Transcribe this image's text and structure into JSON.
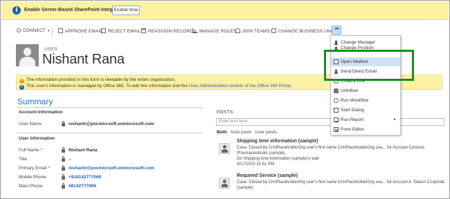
{
  "notification": {
    "text": "Enable Server-Based SharePoint Integration",
    "button": "Enable Now"
  },
  "commands": {
    "connect": "CONNECT",
    "approve_email": "APPROVE EMAIL",
    "reject_email": "REJECT EMAIL",
    "reassign_records": "REASSIGN RECORDS",
    "manage_roles": "MANAGE ROLES",
    "join_teams": "JOIN TEAMS",
    "change_business_unit": "CHANGE BUSINESS UNIT",
    "more": "•••"
  },
  "header": {
    "entity": "USER",
    "name": "Nishant Rana"
  },
  "infostrip": {
    "line1": "The information provided in this form is viewable by the entire organization.",
    "line2_prefix": "This user's information is managed by Office 365. To edit this information visit the ",
    "line2_link": "User Administration section of the Office 365 Portal",
    "line2_suffix": "."
  },
  "summary": {
    "title": "Summary",
    "account_section": "Account Information",
    "user_name_label": "User Name",
    "user_name_value": "nishantr@pocmicrsoft.onmicrosoft.com",
    "user_section": "User Information",
    "full_name_label": "Full Name",
    "full_name_value": "Nishant Rana",
    "title_label": "Title",
    "title_value": "--",
    "primary_email_label": "Primary Email",
    "primary_email_value": "nishantr@pocmicrsoft.onmicrosoft.com",
    "mobile_phone_label": "Mobile Phone",
    "mobile_phone_value": "+918142777069",
    "main_phone_label": "Main Phone",
    "main_phone_value": "08142777069"
  },
  "posts": {
    "title": "POSTS",
    "placeholder": "Enter post here",
    "tabs": [
      "Both",
      "Auto posts",
      "User posts"
    ],
    "items": [
      {
        "title": "Shipping time information (sample)",
        "line1": "Case: Closed by CrmPlaceholderOrg user's first name CrmPlaceholderOrg use...   for Account Contoso",
        "line2": "Pharmaceuticals (sample).",
        "line3": "On Shipping time information (sample)'s wall",
        "line4": "3/17/2015 10:51 PM"
      },
      {
        "title": "Required Service (sample)",
        "line1": "Case: Closed by CrmPlaceholderOrg user's first name CrmPlaceholderOrg use...   for Account A. Datum Corporati",
        "line2": "(sample)."
      }
    ]
  },
  "menu": {
    "items": [
      {
        "label": "Change Manager",
        "icon": "person-icon"
      },
      {
        "label": "Change Position",
        "icon": "person-icon"
      },
      {
        "label": "Open Mailbox",
        "icon": "mailbox-icon"
      },
      {
        "label": "Send Direct Email",
        "icon": "person-icon"
      },
      {
        "label": "Email a Link",
        "icon": "link-icon"
      },
      {
        "label": "Unfollow",
        "icon": "unfollow-icon"
      },
      {
        "label": "Run Workflow",
        "icon": "workflow-icon"
      },
      {
        "label": "Start Dialog",
        "icon": "dialog-icon"
      },
      {
        "label": "Run Report",
        "icon": "report-icon"
      },
      {
        "label": "Form Editor",
        "icon": "form-icon"
      }
    ]
  },
  "colors": {
    "notification_bg": "#fdf2a2",
    "accent_blue": "#1f5fb1",
    "highlight_green": "#1e8a1e",
    "menu_highlight": "#cfe2f6"
  }
}
